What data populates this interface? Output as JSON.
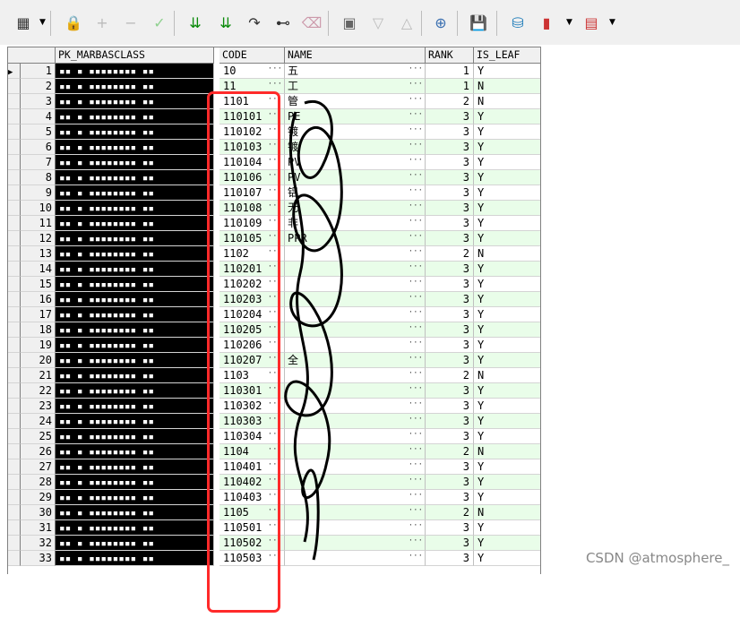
{
  "toolbar": {
    "items": [
      {
        "name": "grid-icon",
        "glyph": "▦"
      },
      {
        "name": "lock-icon",
        "glyph": "🔒"
      },
      {
        "name": "plus-icon",
        "glyph": "+"
      },
      {
        "name": "minus-icon",
        "glyph": "−"
      },
      {
        "name": "check-icon",
        "glyph": "✓"
      },
      {
        "name": "double-down-arrow-icon",
        "glyph": "⇊"
      },
      {
        "name": "double-down-arrow-alt-icon",
        "glyph": "⇊"
      },
      {
        "name": "refresh-icon",
        "glyph": "↷"
      },
      {
        "name": "binoculars-icon",
        "glyph": "⊷"
      },
      {
        "name": "eraser-icon",
        "glyph": "⌫"
      },
      {
        "name": "clear-icon",
        "glyph": "▣"
      },
      {
        "name": "triangle-down-icon",
        "glyph": "▽"
      },
      {
        "name": "triangle-up-icon",
        "glyph": "△"
      },
      {
        "name": "query-icon",
        "glyph": "⊕"
      },
      {
        "name": "save-icon",
        "glyph": "💾"
      },
      {
        "name": "connect-icon",
        "glyph": "⛁"
      },
      {
        "name": "chart-icon",
        "glyph": "▮"
      },
      {
        "name": "table-icon",
        "glyph": "▤"
      }
    ]
  },
  "grid": {
    "columns": [
      "PK_MARBASCLASS",
      "CODE",
      "NAME",
      "RANK",
      "IS_LEAF"
    ],
    "rows": [
      {
        "num": "1",
        "code": "10",
        "name": "五",
        "rank": "1",
        "leaf": "Y"
      },
      {
        "num": "2",
        "code": "11",
        "name": "工",
        "rank": "1",
        "leaf": "N"
      },
      {
        "num": "3",
        "code": "1101",
        "name": "管",
        "rank": "2",
        "leaf": "N"
      },
      {
        "num": "4",
        "code": "110101",
        "name": "PE",
        "rank": "3",
        "leaf": "Y"
      },
      {
        "num": "5",
        "code": "110102",
        "name": "镀",
        "rank": "3",
        "leaf": "Y"
      },
      {
        "num": "6",
        "code": "110103",
        "name": "镀",
        "rank": "3",
        "leaf": "Y"
      },
      {
        "num": "7",
        "code": "110104",
        "name": "PV",
        "rank": "3",
        "leaf": "Y"
      },
      {
        "num": "8",
        "code": "110106",
        "name": "PV",
        "rank": "3",
        "leaf": "Y"
      },
      {
        "num": "9",
        "code": "110107",
        "name": "铝",
        "rank": "3",
        "leaf": "Y"
      },
      {
        "num": "10",
        "code": "110108",
        "name": "无",
        "rank": "3",
        "leaf": "Y"
      },
      {
        "num": "11",
        "code": "110109",
        "name": "非",
        "rank": "3",
        "leaf": "Y"
      },
      {
        "num": "12",
        "code": "110105",
        "name": "PPR",
        "rank": "3",
        "leaf": "Y"
      },
      {
        "num": "13",
        "code": "1102",
        "name": "",
        "rank": "2",
        "leaf": "N"
      },
      {
        "num": "14",
        "code": "110201",
        "name": "",
        "rank": "3",
        "leaf": "Y"
      },
      {
        "num": "15",
        "code": "110202",
        "name": "",
        "rank": "3",
        "leaf": "Y"
      },
      {
        "num": "16",
        "code": "110203",
        "name": "",
        "rank": "3",
        "leaf": "Y"
      },
      {
        "num": "17",
        "code": "110204",
        "name": "",
        "rank": "3",
        "leaf": "Y"
      },
      {
        "num": "18",
        "code": "110205",
        "name": "",
        "rank": "3",
        "leaf": "Y"
      },
      {
        "num": "19",
        "code": "110206",
        "name": "",
        "rank": "3",
        "leaf": "Y"
      },
      {
        "num": "20",
        "code": "110207",
        "name": "全",
        "rank": "3",
        "leaf": "Y"
      },
      {
        "num": "21",
        "code": "1103",
        "name": "",
        "rank": "2",
        "leaf": "N"
      },
      {
        "num": "22",
        "code": "110301",
        "name": "",
        "rank": "3",
        "leaf": "Y"
      },
      {
        "num": "23",
        "code": "110302",
        "name": "",
        "rank": "3",
        "leaf": "Y"
      },
      {
        "num": "24",
        "code": "110303",
        "name": "",
        "rank": "3",
        "leaf": "Y"
      },
      {
        "num": "25",
        "code": "110304",
        "name": "",
        "rank": "3",
        "leaf": "Y"
      },
      {
        "num": "26",
        "code": "1104",
        "name": "",
        "rank": "2",
        "leaf": "N"
      },
      {
        "num": "27",
        "code": "110401",
        "name": "",
        "rank": "3",
        "leaf": "Y"
      },
      {
        "num": "28",
        "code": "110402",
        "name": "",
        "rank": "3",
        "leaf": "Y"
      },
      {
        "num": "29",
        "code": "110403",
        "name": "",
        "rank": "3",
        "leaf": "Y"
      },
      {
        "num": "30",
        "code": "1105",
        "name": "",
        "rank": "2",
        "leaf": "N"
      },
      {
        "num": "31",
        "code": "110501",
        "name": "",
        "rank": "3",
        "leaf": "Y"
      },
      {
        "num": "32",
        "code": "110502",
        "name": "",
        "rank": "3",
        "leaf": "Y"
      },
      {
        "num": "33",
        "code": "110503",
        "name": "",
        "rank": "3",
        "leaf": "Y"
      }
    ]
  },
  "watermark": "CSDN @atmosphere_",
  "colors": {
    "stripe": "#e9fde9",
    "white": "#ffffff",
    "highlight": "#ff2a2a",
    "redacted": "#000000"
  }
}
